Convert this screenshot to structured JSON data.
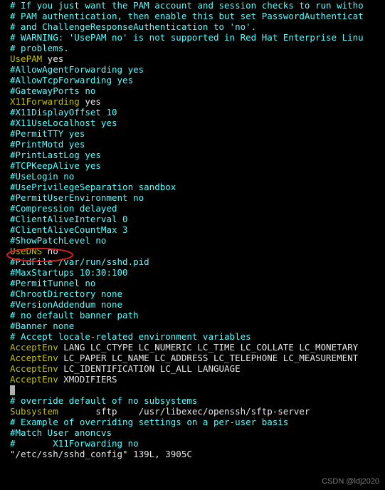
{
  "lines": [
    {
      "segs": [
        {
          "cls": "c",
          "key": "l0",
          "txt": "# If you just want the PAM account and session checks to run witho"
        }
      ]
    },
    {
      "segs": [
        {
          "cls": "c",
          "key": "l1",
          "txt": "# PAM authentication, then enable this but set PasswordAuthenticat"
        }
      ]
    },
    {
      "segs": [
        {
          "cls": "c",
          "key": "l2",
          "txt": "# and ChallengeResponseAuthentication to 'no'."
        }
      ]
    },
    {
      "segs": [
        {
          "cls": "c",
          "key": "l3",
          "txt": "# WARNING: 'UsePAM no' is not supported in Red Hat Enterprise Linu"
        }
      ]
    },
    {
      "segs": [
        {
          "cls": "c",
          "key": "l4",
          "txt": "# problems."
        }
      ]
    },
    {
      "segs": [
        {
          "cls": "key",
          "key": "l5a",
          "txt": "UsePAM"
        },
        {
          "cls": "val",
          "key": "l5b",
          "txt": " yes"
        }
      ]
    },
    {
      "segs": [
        {
          "cls": "c",
          "key": "l6",
          "txt": ""
        }
      ]
    },
    {
      "segs": [
        {
          "cls": "c",
          "key": "l7",
          "txt": "#AllowAgentForwarding yes"
        }
      ]
    },
    {
      "segs": [
        {
          "cls": "c",
          "key": "l8",
          "txt": "#AllowTcpForwarding yes"
        }
      ]
    },
    {
      "segs": [
        {
          "cls": "c",
          "key": "l9",
          "txt": "#GatewayPorts no"
        }
      ]
    },
    {
      "segs": [
        {
          "cls": "key",
          "key": "l10a",
          "txt": "X11Forwarding"
        },
        {
          "cls": "val",
          "key": "l10b",
          "txt": " yes"
        }
      ]
    },
    {
      "segs": [
        {
          "cls": "c",
          "key": "l11",
          "txt": "#X11DisplayOffset 10"
        }
      ]
    },
    {
      "segs": [
        {
          "cls": "c",
          "key": "l12",
          "txt": "#X11UseLocalhost yes"
        }
      ]
    },
    {
      "segs": [
        {
          "cls": "c",
          "key": "l13",
          "txt": "#PermitTTY yes"
        }
      ]
    },
    {
      "segs": [
        {
          "cls": "c",
          "key": "l14",
          "txt": "#PrintMotd yes"
        }
      ]
    },
    {
      "segs": [
        {
          "cls": "c",
          "key": "l15",
          "txt": "#PrintLastLog yes"
        }
      ]
    },
    {
      "segs": [
        {
          "cls": "c",
          "key": "l16",
          "txt": "#TCPKeepAlive yes"
        }
      ]
    },
    {
      "segs": [
        {
          "cls": "c",
          "key": "l17",
          "txt": "#UseLogin no"
        }
      ]
    },
    {
      "segs": [
        {
          "cls": "c",
          "key": "l18",
          "txt": "#UsePrivilegeSeparation sandbox"
        }
      ]
    },
    {
      "segs": [
        {
          "cls": "c",
          "key": "l19",
          "txt": "#PermitUserEnvironment no"
        }
      ]
    },
    {
      "segs": [
        {
          "cls": "c",
          "key": "l20",
          "txt": "#Compression delayed"
        }
      ]
    },
    {
      "segs": [
        {
          "cls": "c",
          "key": "l21",
          "txt": "#ClientAliveInterval 0"
        }
      ]
    },
    {
      "segs": [
        {
          "cls": "c",
          "key": "l22",
          "txt": "#ClientAliveCountMax 3"
        }
      ]
    },
    {
      "segs": [
        {
          "cls": "c",
          "key": "l23",
          "txt": "#ShowPatchLevel no"
        }
      ]
    },
    {
      "segs": [
        {
          "cls": "key",
          "key": "l24a",
          "txt": "UseDNS"
        },
        {
          "cls": "val",
          "key": "l24b",
          "txt": " no"
        }
      ]
    },
    {
      "segs": [
        {
          "cls": "c",
          "key": "l25",
          "txt": "#PidFile /var/run/sshd.pid"
        }
      ]
    },
    {
      "segs": [
        {
          "cls": "c",
          "key": "l26",
          "txt": "#MaxStartups 10:30:100"
        }
      ]
    },
    {
      "segs": [
        {
          "cls": "c",
          "key": "l27",
          "txt": "#PermitTunnel no"
        }
      ]
    },
    {
      "segs": [
        {
          "cls": "c",
          "key": "l28",
          "txt": "#ChrootDirectory none"
        }
      ]
    },
    {
      "segs": [
        {
          "cls": "c",
          "key": "l29",
          "txt": "#VersionAddendum none"
        }
      ]
    },
    {
      "segs": [
        {
          "cls": "c",
          "key": "l30",
          "txt": ""
        }
      ]
    },
    {
      "segs": [
        {
          "cls": "c",
          "key": "l31",
          "txt": "# no default banner path"
        }
      ]
    },
    {
      "segs": [
        {
          "cls": "c",
          "key": "l32",
          "txt": "#Banner none"
        }
      ]
    },
    {
      "segs": [
        {
          "cls": "c",
          "key": "l33",
          "txt": ""
        }
      ]
    },
    {
      "segs": [
        {
          "cls": "c",
          "key": "l34",
          "txt": "# Accept locale-related environment variables"
        }
      ]
    },
    {
      "segs": [
        {
          "cls": "key",
          "key": "l35a",
          "txt": "AcceptEnv"
        },
        {
          "cls": "val",
          "key": "l35b",
          "txt": " LANG LC_CTYPE LC_NUMERIC LC_TIME LC_COLLATE LC_MONETARY"
        }
      ]
    },
    {
      "segs": [
        {
          "cls": "key",
          "key": "l36a",
          "txt": "AcceptEnv"
        },
        {
          "cls": "val",
          "key": "l36b",
          "txt": " LC_PAPER LC_NAME LC_ADDRESS LC_TELEPHONE LC_MEASUREMENT"
        }
      ]
    },
    {
      "segs": [
        {
          "cls": "key",
          "key": "l37a",
          "txt": "AcceptEnv"
        },
        {
          "cls": "val",
          "key": "l37b",
          "txt": " LC_IDENTIFICATION LC_ALL LANGUAGE"
        }
      ]
    },
    {
      "segs": [
        {
          "cls": "key",
          "key": "l38a",
          "txt": "AcceptEnv"
        },
        {
          "cls": "val",
          "key": "l38b",
          "txt": " XMODIFIERS"
        }
      ]
    },
    {
      "cursor": true,
      "segs": []
    },
    {
      "segs": [
        {
          "cls": "c",
          "key": "l40",
          "txt": "# override default of no subsystems"
        }
      ]
    },
    {
      "segs": [
        {
          "cls": "key",
          "key": "l41a",
          "txt": "Subsystem"
        },
        {
          "cls": "val",
          "key": "l41b",
          "txt": "       sftp    /usr/libexec/openssh/sftp-server"
        }
      ]
    },
    {
      "segs": [
        {
          "cls": "c",
          "key": "l42",
          "txt": ""
        }
      ]
    },
    {
      "segs": [
        {
          "cls": "c",
          "key": "l43",
          "txt": "# Example of overriding settings on a per-user basis"
        }
      ]
    },
    {
      "segs": [
        {
          "cls": "c",
          "key": "l44",
          "txt": "#Match User anoncvs"
        }
      ]
    },
    {
      "segs": [
        {
          "cls": "c",
          "key": "l45",
          "txt": "#       X11Forwarding no"
        }
      ]
    },
    {
      "segs": [
        {
          "cls": "val",
          "key": "l46",
          "txt": "\"/etc/ssh/sshd_config\" 139L, 3905C"
        }
      ]
    }
  ],
  "watermark": "CSDN @ldj2020"
}
